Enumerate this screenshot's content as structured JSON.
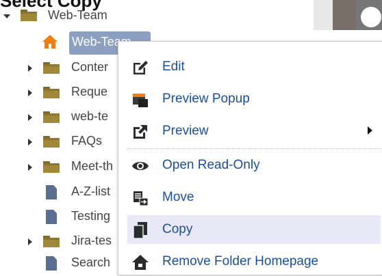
{
  "page_title": "Select Copy",
  "tree": {
    "root_label": "Web-Team",
    "selected_label": "Web-Team",
    "items": [
      {
        "label": "Conter",
        "type": "folder",
        "expandable": true
      },
      {
        "label": "Reque",
        "type": "folder",
        "expandable": true
      },
      {
        "label": "web-te",
        "type": "folder",
        "expandable": true
      },
      {
        "label": "FAQs",
        "type": "folder",
        "expandable": true
      },
      {
        "label": "Meet-th",
        "type": "folder",
        "expandable": true
      },
      {
        "label": "A-Z-list",
        "type": "document",
        "expandable": false
      },
      {
        "label": "Testing",
        "type": "document",
        "expandable": false
      },
      {
        "label": "Jira-tes",
        "type": "folder",
        "expandable": true
      },
      {
        "label": "Search",
        "type": "document",
        "expandable": false
      }
    ]
  },
  "context_menu": {
    "items": [
      {
        "label": "Edit",
        "icon": "edit-icon"
      },
      {
        "label": "Preview Popup",
        "icon": "preview-popup-icon"
      },
      {
        "label": "Preview",
        "icon": "external-link-icon",
        "submenu": true
      },
      {
        "label": "Open Read-Only",
        "icon": "eye-icon"
      },
      {
        "label": "Move",
        "icon": "move-icon"
      },
      {
        "label": "Copy",
        "icon": "copy-icon",
        "highlighted": true
      },
      {
        "label": "Remove Folder Homepage",
        "icon": "home-icon"
      }
    ]
  },
  "colors": {
    "menu_text": "#1a4fa0",
    "selection": "#8ca0c2",
    "folder": "#a08838",
    "document": "#5a6f90",
    "highlight": "#e8e8f6"
  }
}
